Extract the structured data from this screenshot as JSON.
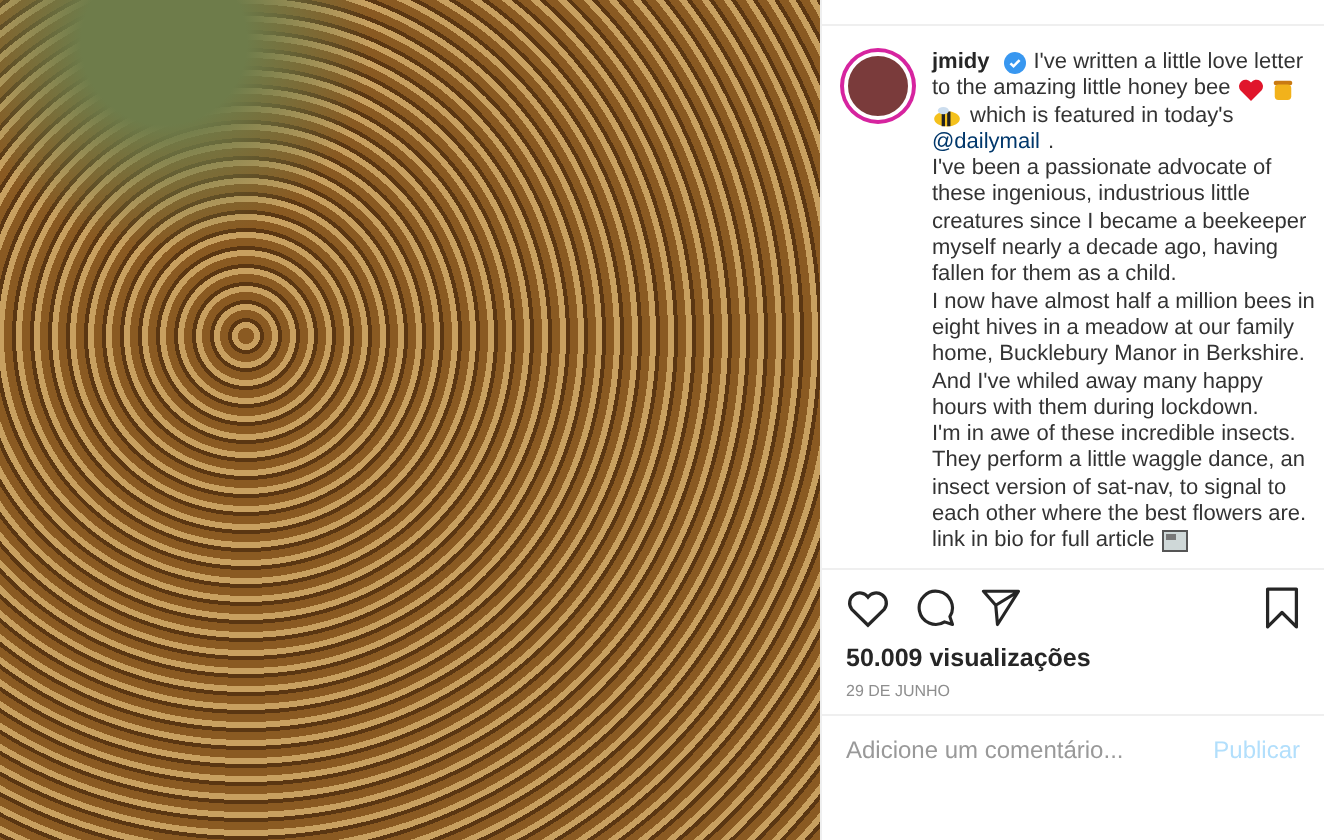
{
  "post": {
    "username": "jmidy",
    "verified": true,
    "caption_lines": [
      "I've written a little love letter",
      "to the amazing little honey bee"
    ],
    "caption_after_icons": "which is featured in today's",
    "mention": "@dailymail",
    "mention_end": ".",
    "paragraphs": [
      "I've been a passionate advocate of these ingenious, industrious little creatures since I became a beekeeper myself nearly a decade ago, having fallen for them as a child.",
      "I now have almost half a million bees in eight hives in a meadow at our family home, Bucklebury Manor in Berkshire. And I've whiled away many happy hours with them during lockdown.",
      "I'm in awe of these incredible insects. They perform a little waggle dance, an insect version of sat-nav, to signal to each other where the best flowers are."
    ],
    "last_line": "link in bio for full article",
    "liked": false,
    "saved": false,
    "views": "50.009 visualizações",
    "date": "29 DE JUNHO"
  },
  "comment": {
    "placeholder": "Adicione um comentário...",
    "button": "Publicar"
  }
}
